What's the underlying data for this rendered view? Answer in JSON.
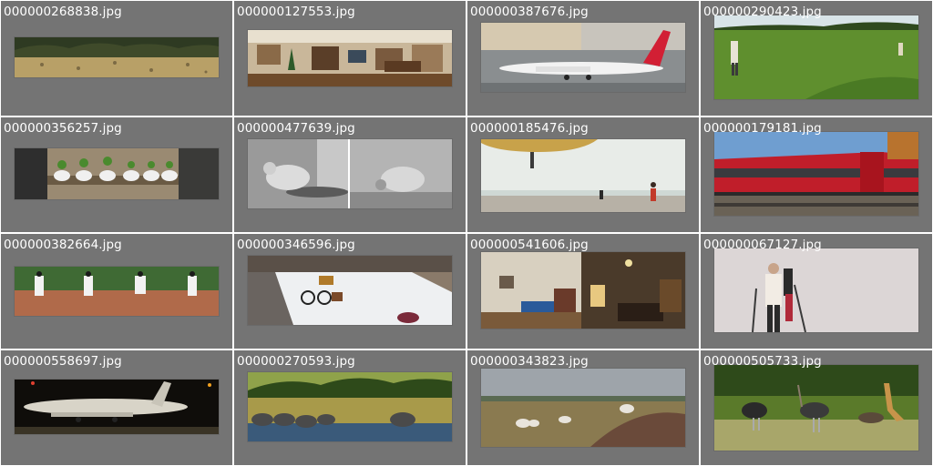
{
  "tiles": [
    {
      "filename": "000000268838.jpg",
      "image": "field-dry-grass-trees"
    },
    {
      "filename": "000000127553.jpg",
      "image": "living-room-panorama"
    },
    {
      "filename": "000000387676.jpg",
      "image": "airplane-on-tarmac-red-tail"
    },
    {
      "filename": "000000290423.jpg",
      "image": "people-on-green-lawn"
    },
    {
      "filename": "000000356257.jpg",
      "image": "sneaker-planters-on-wall"
    },
    {
      "filename": "000000477639.jpg",
      "image": "sheep-feeding-black-and-white"
    },
    {
      "filename": "000000185476.jpg",
      "image": "beach-kite-person"
    },
    {
      "filename": "000000179181.jpg",
      "image": "red-passenger-train"
    },
    {
      "filename": "000000382664.jpg",
      "image": "baseball-pitcher-sequence"
    },
    {
      "filename": "000000346596.jpg",
      "image": "bicycle-in-snow-street"
    },
    {
      "filename": "000000541606.jpg",
      "image": "living-room-interiors"
    },
    {
      "filename": "000000067127.jpg",
      "image": "skiers-in-snow"
    },
    {
      "filename": "000000558697.jpg",
      "image": "airplane-at-night"
    },
    {
      "filename": "000000270593.jpg",
      "image": "elephants-by-lake"
    },
    {
      "filename": "000000343823.jpg",
      "image": "sheep-on-moor"
    },
    {
      "filename": "000000505733.jpg",
      "image": "ostriches-and-giraffe"
    }
  ],
  "colors": {
    "tile_bg": "#747474",
    "grid_gap": "#ffffff",
    "label": "#ffffff"
  }
}
